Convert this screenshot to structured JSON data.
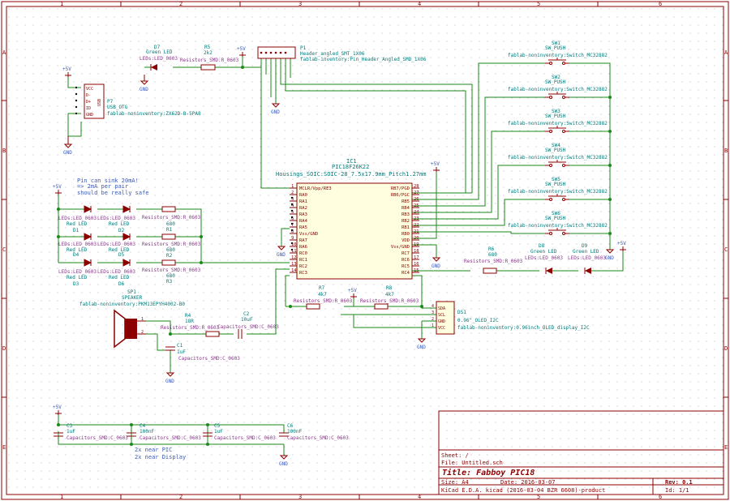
{
  "frame": {
    "col_labels": [
      "1",
      "2",
      "3",
      "4",
      "5",
      "6"
    ],
    "row_labels": [
      "A",
      "B",
      "C",
      "D",
      "E"
    ]
  },
  "title_block": {
    "sheet": "Sheet: /",
    "file": "File: Untitled.sch",
    "title": "Title: Fabboy PIC18",
    "size": "Size: A4",
    "date": "Date: 2016-03-07",
    "rev": "Rev: 0.1",
    "kicad": "KiCad E.D.A.  kicad (2016-03-04 BZR 6608)-product",
    "id": "Id: 1/1"
  },
  "power": {
    "plus5v": "+5V",
    "gnd": "GND"
  },
  "ic1": {
    "ref": "IC1",
    "value": "PIC18F26K22",
    "footprint": "Housings_SOIC:SOIC-28_7.5x17.9mm_Pitch1.27mm",
    "left_pins": [
      {
        "num": "1",
        "name": "MCLR/Vpp/RE3"
      },
      {
        "num": "2",
        "name": "RA0"
      },
      {
        "num": "3",
        "name": "RA1"
      },
      {
        "num": "4",
        "name": "RA2"
      },
      {
        "num": "5",
        "name": "RA3"
      },
      {
        "num": "6",
        "name": "RA4"
      },
      {
        "num": "7",
        "name": "RA5"
      },
      {
        "num": "8",
        "name": "Vss/GND"
      },
      {
        "num": "9",
        "name": "RA7"
      },
      {
        "num": "10",
        "name": "RA6"
      },
      {
        "num": "11",
        "name": "RC0"
      },
      {
        "num": "12",
        "name": "RC1"
      },
      {
        "num": "13",
        "name": "RC2"
      },
      {
        "num": "14",
        "name": "RC3"
      }
    ],
    "right_pins": [
      {
        "num": "28",
        "name": "RB7/PGD"
      },
      {
        "num": "27",
        "name": "RB6/PGC"
      },
      {
        "num": "26",
        "name": "RB5"
      },
      {
        "num": "25",
        "name": "RB4"
      },
      {
        "num": "24",
        "name": "RB3"
      },
      {
        "num": "23",
        "name": "RB2"
      },
      {
        "num": "22",
        "name": "RB1"
      },
      {
        "num": "21",
        "name": "RB0"
      },
      {
        "num": "20",
        "name": "VDD"
      },
      {
        "num": "19",
        "name": "Vss/GND"
      },
      {
        "num": "18",
        "name": "RC7"
      },
      {
        "num": "17",
        "name": "RC6"
      },
      {
        "num": "16",
        "name": "RC5"
      },
      {
        "num": "15",
        "name": "RC4"
      }
    ]
  },
  "p1": {
    "ref": "P1",
    "value": "Header_angled_SMT_1X06",
    "footprint": "fablab-inventory:Pin_Header_Angled_SMD_1X06"
  },
  "p7": {
    "ref": "P7",
    "value": "USB_OTG",
    "footprint": "fablab-noninventory:ZX62D-B-5PA8",
    "pins": [
      "VCC",
      "D-",
      "D+",
      "ID",
      "GND"
    ],
    "connector_label": "USB"
  },
  "d7": {
    "ref": "D7",
    "value": "Green LED",
    "footprint": "LEDs:LED_0603"
  },
  "r5": {
    "ref": "R5",
    "value": "2k2",
    "footprint": "Resistors_SMD:R_0603"
  },
  "switches": [
    {
      "ref": "SW1",
      "value": "SW_PUSH",
      "footprint": "fablab-noninventory:Switch_MC32882"
    },
    {
      "ref": "SW2",
      "value": "SW_PUSH",
      "footprint": "fablab-noninventory:Switch_MC32882"
    },
    {
      "ref": "SW3",
      "value": "SW_PUSH",
      "footprint": "fablab-noninventory:Switch_MC32882"
    },
    {
      "ref": "SW4",
      "value": "SW_PUSH",
      "footprint": "fablab-noninventory:Switch_MC32882"
    },
    {
      "ref": "SW5",
      "value": "SW_PUSH",
      "footprint": "fablab-noninventory:Switch_MC32882"
    },
    {
      "ref": "SW6",
      "value": "SW_PUSH",
      "footprint": "fablab-noninventory:Switch_MC32882"
    }
  ],
  "note": [
    "Pin can sink 20mA!",
    "=> 2mA per pair",
    "should be really safe"
  ],
  "leds": {
    "d1": {
      "ref": "D1",
      "value": "Red LED",
      "footprint": "LEDs:LED_0603"
    },
    "d2": {
      "ref": "D2",
      "value": "Red LED",
      "footprint": "LEDs:LED_0603"
    },
    "d3": {
      "ref": "D3",
      "value": "Red LED",
      "footprint": "LEDs:LED_0603"
    },
    "d4": {
      "ref": "D4",
      "value": "Red LED",
      "footprint": "LEDs:LED_0603"
    },
    "d5": {
      "ref": "D5",
      "value": "Red LED",
      "footprint": "LEDs:LED_0603"
    },
    "d6": {
      "ref": "D6",
      "value": "Red LED",
      "footprint": "LEDs:LED_0603"
    },
    "d8": {
      "ref": "D8",
      "value": "Green LED",
      "footprint": "LEDs:LED_0603"
    },
    "d9": {
      "ref": "D9",
      "value": "Green LED",
      "footprint": "LEDs:LED_0603"
    }
  },
  "resistors": {
    "r1": {
      "ref": "R1",
      "value": "680",
      "footprint": "Resistors_SMD:R_0603"
    },
    "r2": {
      "ref": "R2",
      "value": "680",
      "footprint": "Resistors_SMD:R_0603"
    },
    "r3": {
      "ref": "R3",
      "value": "680",
      "footprint": "Resistors_SMD:R_0603"
    },
    "r4": {
      "ref": "R4",
      "value": "18R",
      "footprint": "Resistors_SMD:R_0603"
    },
    "r6": {
      "ref": "R6",
      "value": "680",
      "footprint": "Resistors_SMD:R_0603"
    },
    "r7": {
      "ref": "R7",
      "value": "4k7",
      "footprint": "Resistors_SMD:R_0603"
    },
    "r8": {
      "ref": "R8",
      "value": "4k7",
      "footprint": "Resistors_SMD:R_0603"
    }
  },
  "sp1": {
    "ref": "SP1",
    "value": "SPEAKER",
    "footprint": "fablab-noninventory:PKM13EPYH4002-B0",
    "pin1": "1",
    "pin2": "2"
  },
  "caps": {
    "c1": {
      "ref": "C1",
      "value": "1uF",
      "footprint": "Capacitors_SMD:C_0603"
    },
    "c2": {
      "ref": "C2",
      "value": "10uF",
      "footprint": "Capacitors_SMD:C_0603"
    },
    "c3": {
      "ref": "C3",
      "value": "1uF",
      "footprint": "Capacitors_SMD:C_0603"
    },
    "c4": {
      "ref": "C4",
      "value": "100nF",
      "footprint": "Capacitors_SMD:C_0603"
    },
    "c5": {
      "ref": "C5",
      "value": "1uF",
      "footprint": "Capacitors_SMD:C_0603"
    },
    "c6": {
      "ref": "C6",
      "value": "100nF",
      "footprint": "Capacitors_SMD:C_0603"
    }
  },
  "ds1": {
    "ref": "DS1",
    "value": "0.96\"_OLED_I2C",
    "footprint": "fablab-noninventory:0.96inch_OLED_display_I2C",
    "pins": [
      {
        "num": "4",
        "name": "SDA"
      },
      {
        "num": "3",
        "name": "SCL"
      },
      {
        "num": "2",
        "name": "GND"
      },
      {
        "num": "1",
        "name": "VCC"
      }
    ]
  },
  "cap_notes": [
    "2x near PIC",
    "2x near Display"
  ]
}
